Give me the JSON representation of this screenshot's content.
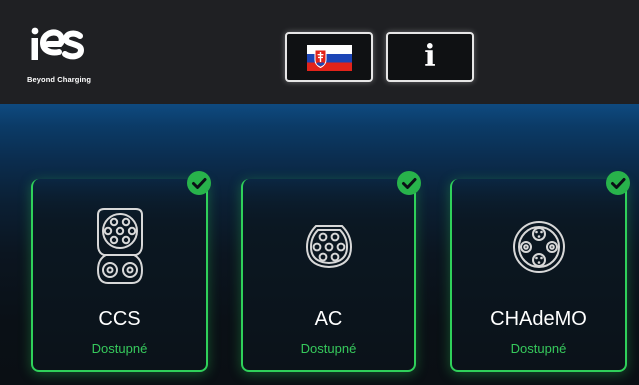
{
  "header": {
    "logo_text": "ies",
    "tagline": "Beyond Charging",
    "language_flag": "slovakia-flag",
    "info_glyph": "i"
  },
  "colors": {
    "available": "#36c95c",
    "check": "#28b34b",
    "header_bg": "#1f2023",
    "accent_blue": "#0e4a80"
  },
  "connectors": [
    {
      "name": "CCS",
      "status": "Dostupné",
      "icon": "ccs-connector-icon"
    },
    {
      "name": "AC",
      "status": "Dostupné",
      "icon": "type2-connector-icon"
    },
    {
      "name": "CHAdeMO",
      "status": "Dostupné",
      "icon": "chademo-connector-icon"
    }
  ]
}
